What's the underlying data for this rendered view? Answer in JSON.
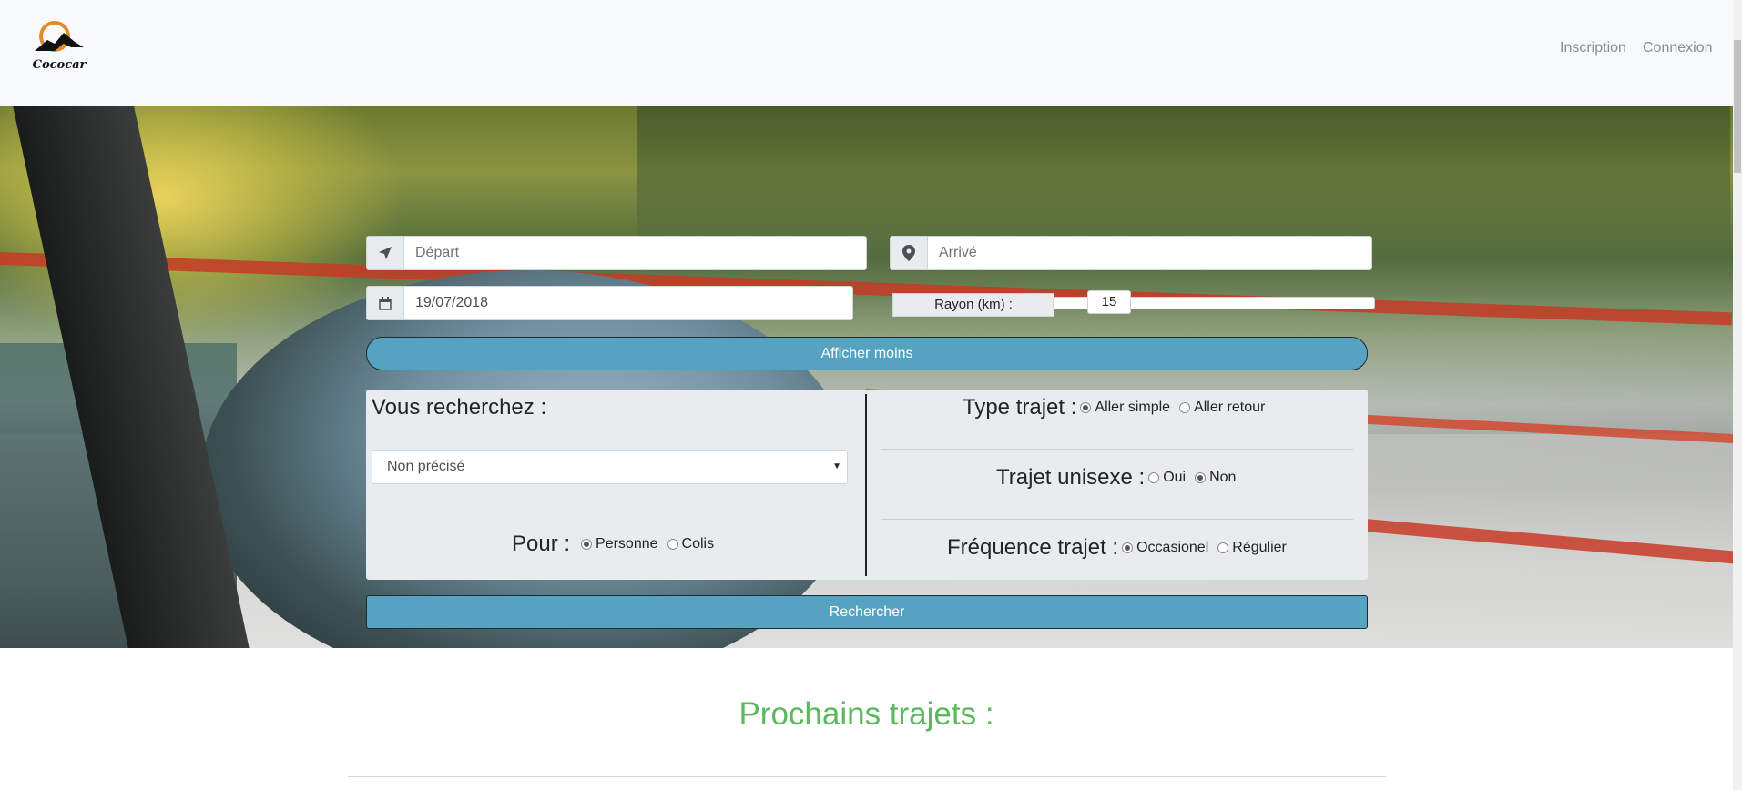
{
  "brand": {
    "name": "Cococar"
  },
  "nav": {
    "inscription": "Inscription",
    "connexion": "Connexion"
  },
  "search": {
    "depart_placeholder": "Départ",
    "arrive_placeholder": "Arrivé",
    "date_value": "19/07/2018",
    "rayon_label": "Rayon (km) :",
    "rayon_value": "15",
    "toggle_label": "Afficher moins",
    "submit_label": "Rechercher"
  },
  "filters": {
    "vous_recherchez_label": "Vous recherchez :",
    "vous_recherchez_selected": "Non précisé",
    "pour_label": "Pour :",
    "pour_options": [
      "Personne",
      "Colis"
    ],
    "pour_selected": "Personne",
    "type_trajet_label": "Type trajet :",
    "type_trajet_options": [
      "Aller simple",
      "Aller retour"
    ],
    "type_trajet_selected": "Aller simple",
    "unisexe_label": "Trajet unisexe :",
    "unisexe_options": [
      "Oui",
      "Non"
    ],
    "unisexe_selected": "Non",
    "frequence_label": "Fréquence trajet :",
    "frequence_options": [
      "Occasionel",
      "Régulier"
    ],
    "frequence_selected": "Occasionel"
  },
  "section": {
    "prochains_trajets_title": "Prochains trajets :"
  },
  "colors": {
    "button": "#56a3c1",
    "section_title": "#5cb85c",
    "navbar_bg": "#f8f9fa"
  },
  "icons": {
    "depart": "location-arrow-icon",
    "arrive": "map-marker-icon",
    "date": "calendar-icon"
  }
}
